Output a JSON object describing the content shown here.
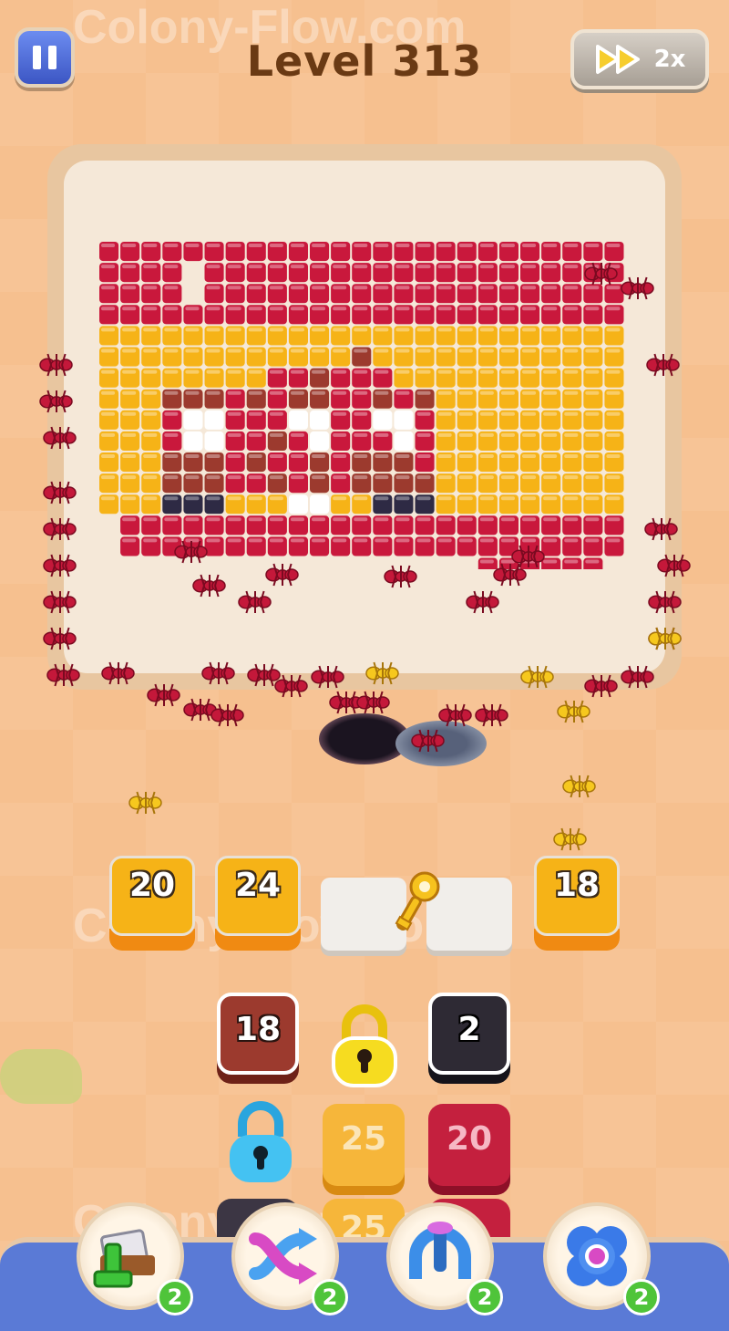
{
  "header": {
    "level_label": "Level 313",
    "speed_label": "2x"
  },
  "watermark": "Colony-Flow.com",
  "slots": [
    {
      "value": "20",
      "color": "#f6b317",
      "state": "filled"
    },
    {
      "value": "24",
      "color": "#f6b317",
      "state": "filled"
    },
    {
      "value": "",
      "state": "locked-key"
    },
    {
      "value": "",
      "state": "empty"
    },
    {
      "value": "18",
      "color": "#f6b317",
      "state": "filled"
    }
  ],
  "queue": [
    {
      "value": "18",
      "color": "#9c3a2e"
    },
    {
      "value": "",
      "color": "#f2d21a",
      "icon": "padlock-icon"
    },
    {
      "value": "2",
      "color": "#2e2a34"
    },
    {
      "value": "",
      "color": "#38b8ea",
      "icon": "padlock-icon"
    },
    {
      "value": "25",
      "color": "#f6b63a"
    },
    {
      "value": "20",
      "color": "#c4203e"
    },
    {
      "value": "25",
      "color": "#f6b63a"
    }
  ],
  "boosters": [
    {
      "name": "add-slot-booster",
      "count": "2"
    },
    {
      "name": "shuffle-booster",
      "count": "2"
    },
    {
      "name": "magnet-booster",
      "count": "2"
    },
    {
      "name": "portal-booster",
      "count": "2"
    }
  ],
  "colors": {
    "red": "#c9183c",
    "yellow": "#f6b317",
    "brown": "#9c3a2e",
    "white": "#ffffff",
    "dark": "#2e2a44"
  }
}
